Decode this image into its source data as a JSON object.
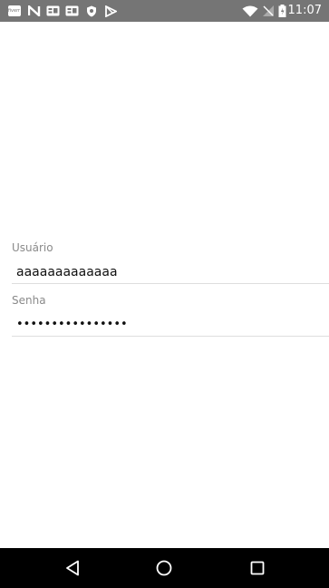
{
  "status_bar": {
    "time": "11:07",
    "notification_icons": [
      "fiverr-icon",
      "n-icon",
      "news-icon",
      "news-icon",
      "shield-icon",
      "play-store-icon"
    ],
    "notification_badge_text": "fiverr",
    "system_icons": [
      "wifi-icon",
      "no-signal-icon",
      "battery-icon"
    ]
  },
  "login_form": {
    "username": {
      "label": "Usuário",
      "value": "aaaaaaaaaaaaa"
    },
    "password": {
      "label": "Senha",
      "value": "aaaaaaaaaaaaaaaa"
    }
  },
  "nav_bar": {
    "buttons": [
      "back-icon",
      "home-icon",
      "recents-icon"
    ]
  },
  "colors": {
    "status_bar_bg": "#757575",
    "nav_bar_bg": "#000000",
    "label": "#8a8a8a",
    "divider": "#dedede"
  }
}
